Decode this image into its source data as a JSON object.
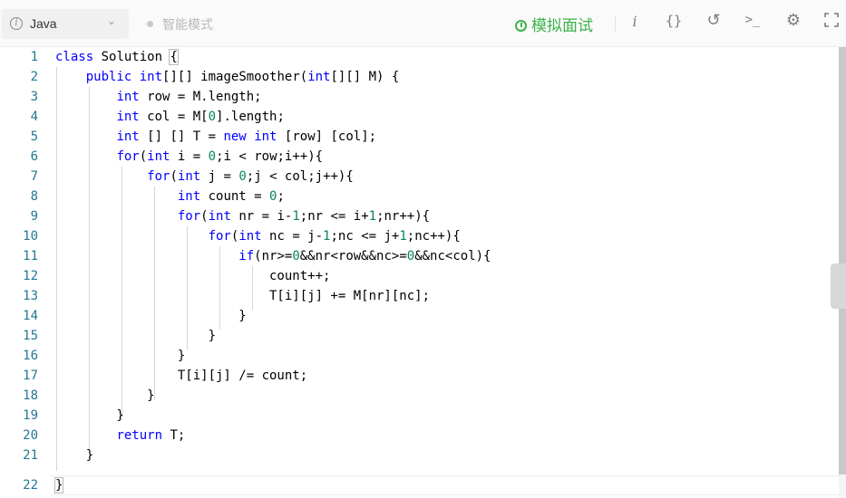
{
  "toolbar": {
    "language": "Java",
    "smart_mode_label": "智能模式",
    "mock_interview_label": "模拟面试",
    "icons": [
      "info-icon",
      "code-braces-icon",
      "reset-icon",
      "terminal-icon",
      "settings-icon",
      "fullscreen-icon"
    ]
  },
  "editor": {
    "current_line": 22,
    "lines": [
      {
        "n": "1",
        "text": "class Solution {"
      },
      {
        "n": "2",
        "text": "    public int[][] imageSmoother(int[][] M) {"
      },
      {
        "n": "3",
        "text": "        int row = M.length;"
      },
      {
        "n": "4",
        "text": "        int col = M[0].length;"
      },
      {
        "n": "5",
        "text": "        int [] [] T = new int [row] [col];"
      },
      {
        "n": "6",
        "text": "        for(int i = 0;i < row;i++){"
      },
      {
        "n": "7",
        "text": "            for(int j = 0;j < col;j++){"
      },
      {
        "n": "8",
        "text": "                int count = 0;"
      },
      {
        "n": "9",
        "text": "                for(int nr = i-1;nr <= i+1;nr++){"
      },
      {
        "n": "10",
        "text": "                    for(int nc = j-1;nc <= j+1;nc++){"
      },
      {
        "n": "11",
        "text": "                        if(nr>=0&&nr<row&&nc>=0&&nc<col){"
      },
      {
        "n": "12",
        "text": "                            count++;"
      },
      {
        "n": "13",
        "text": "                            T[i][j] += M[nr][nc];"
      },
      {
        "n": "14",
        "text": "                        }"
      },
      {
        "n": "15",
        "text": "                    }"
      },
      {
        "n": "16",
        "text": "                }"
      },
      {
        "n": "17",
        "text": "                T[i][j] /= count;"
      },
      {
        "n": "18",
        "text": "            }"
      },
      {
        "n": "19",
        "text": "        }"
      },
      {
        "n": "20",
        "text": "        return T;"
      },
      {
        "n": "21",
        "text": "    }"
      },
      {
        "n": "22",
        "text": "}"
      }
    ]
  }
}
